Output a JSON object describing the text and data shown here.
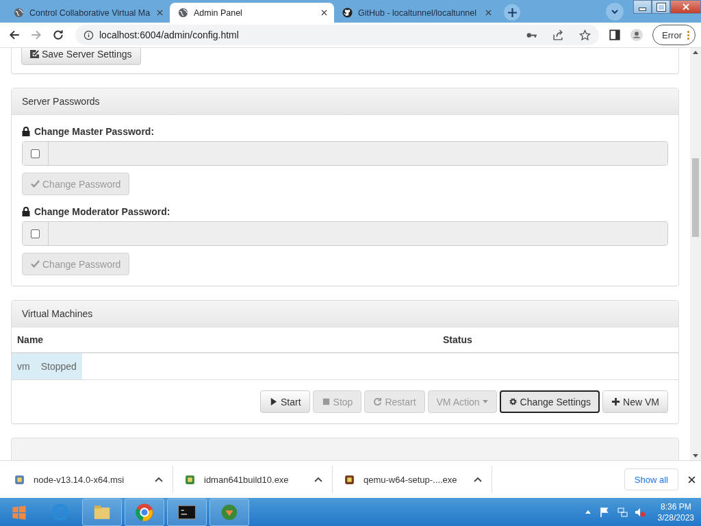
{
  "browser": {
    "tabs": [
      {
        "title": "Control Collaborative Virtual Ma",
        "selected": false
      },
      {
        "title": "Admin Panel",
        "selected": true
      },
      {
        "title": "GitHub - localtunnel/localtunnel",
        "selected": false
      }
    ],
    "address": "localhost:6004/admin/config.html",
    "profile_button": "Error"
  },
  "save_button": "Save Server Settings",
  "passwords_panel": {
    "title": "Server Passwords",
    "fields": [
      {
        "label": "Change Master Password:",
        "checked": false,
        "disabled": true,
        "button": "Change Password"
      },
      {
        "label": "Change Moderator Password:",
        "checked": false,
        "disabled": true,
        "button": "Change Password"
      }
    ]
  },
  "vm_panel": {
    "title": "Virtual Machines",
    "columns": [
      "Name",
      "Status"
    ],
    "rows": [
      {
        "name": "vm",
        "status": "Stopped",
        "selected": true
      }
    ],
    "buttons": [
      {
        "label": "Start",
        "kind": "start",
        "disabled": false,
        "focused": false
      },
      {
        "label": "Stop",
        "kind": "stop",
        "disabled": true,
        "focused": false
      },
      {
        "label": "Restart",
        "kind": "restart",
        "disabled": true,
        "focused": false
      },
      {
        "label": "VM Action",
        "kind": "dropdown",
        "disabled": true,
        "focused": false
      },
      {
        "label": "Change Settings",
        "kind": "settings",
        "disabled": false,
        "focused": true
      },
      {
        "label": "New VM",
        "kind": "add",
        "disabled": false,
        "focused": false
      }
    ]
  },
  "downloads": {
    "items": [
      "node-v13.14.0-x64.msi",
      "idman641build10.exe",
      "qemu-w64-setup-....exe"
    ],
    "show_all": "Show all"
  },
  "taskbar": {
    "time": "8:36 PM",
    "date": "3/28/2023"
  }
}
